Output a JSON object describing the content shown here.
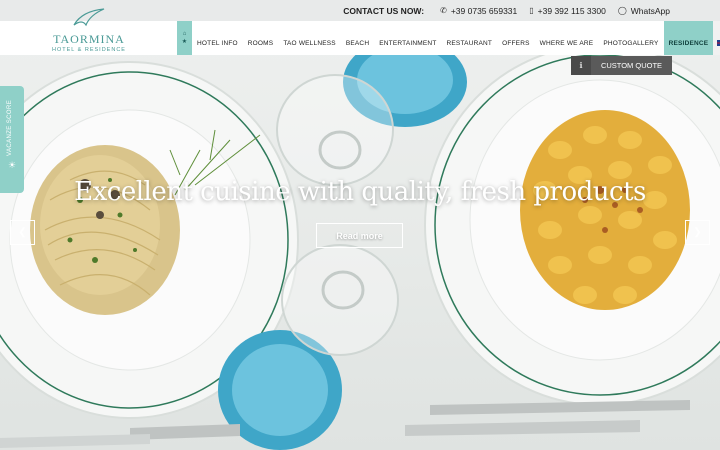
{
  "topbar": {
    "contact_label": "CONTACT US NOW:",
    "phone_1": "+39 0735 659331",
    "phone_2": "+39 392 115 3300",
    "whatsapp": "WhatsApp"
  },
  "logo": {
    "name": "TAORMINA",
    "subtitle": "HOTEL & RESIDENCE"
  },
  "nav": {
    "items": [
      {
        "label": "HOTEL INFO"
      },
      {
        "label": "ROOMS"
      },
      {
        "label": "TAO WELLNESS"
      },
      {
        "label": "BEACH"
      },
      {
        "label": "ENTERTAINMENT"
      },
      {
        "label": "RESTAURANT"
      },
      {
        "label": "OFFERS"
      },
      {
        "label": "WHERE WE ARE"
      },
      {
        "label": "PHOTOGALLERY"
      },
      {
        "label": "RESIDENCE"
      }
    ],
    "active": "RESIDENCE"
  },
  "quote": {
    "label": "CUSTOM QUOTE"
  },
  "side_tab": {
    "label": "VACANZE SCORE"
  },
  "hero": {
    "headline": "Excellent cuisine with quality, fresh products",
    "button": "Read more"
  },
  "icons": {
    "home": "home-icon",
    "star": "star-icon",
    "phone": "phone-icon",
    "mobile": "mobile-icon",
    "whatsapp": "whatsapp-icon",
    "info": "info-icon",
    "prev": "chevron-left-icon",
    "next": "chevron-right-icon",
    "flag": "uk-flag-icon"
  },
  "colors": {
    "accent": "#8fd0c8",
    "logo": "#4a9a96",
    "quote_bg": "#5a5a5a"
  }
}
